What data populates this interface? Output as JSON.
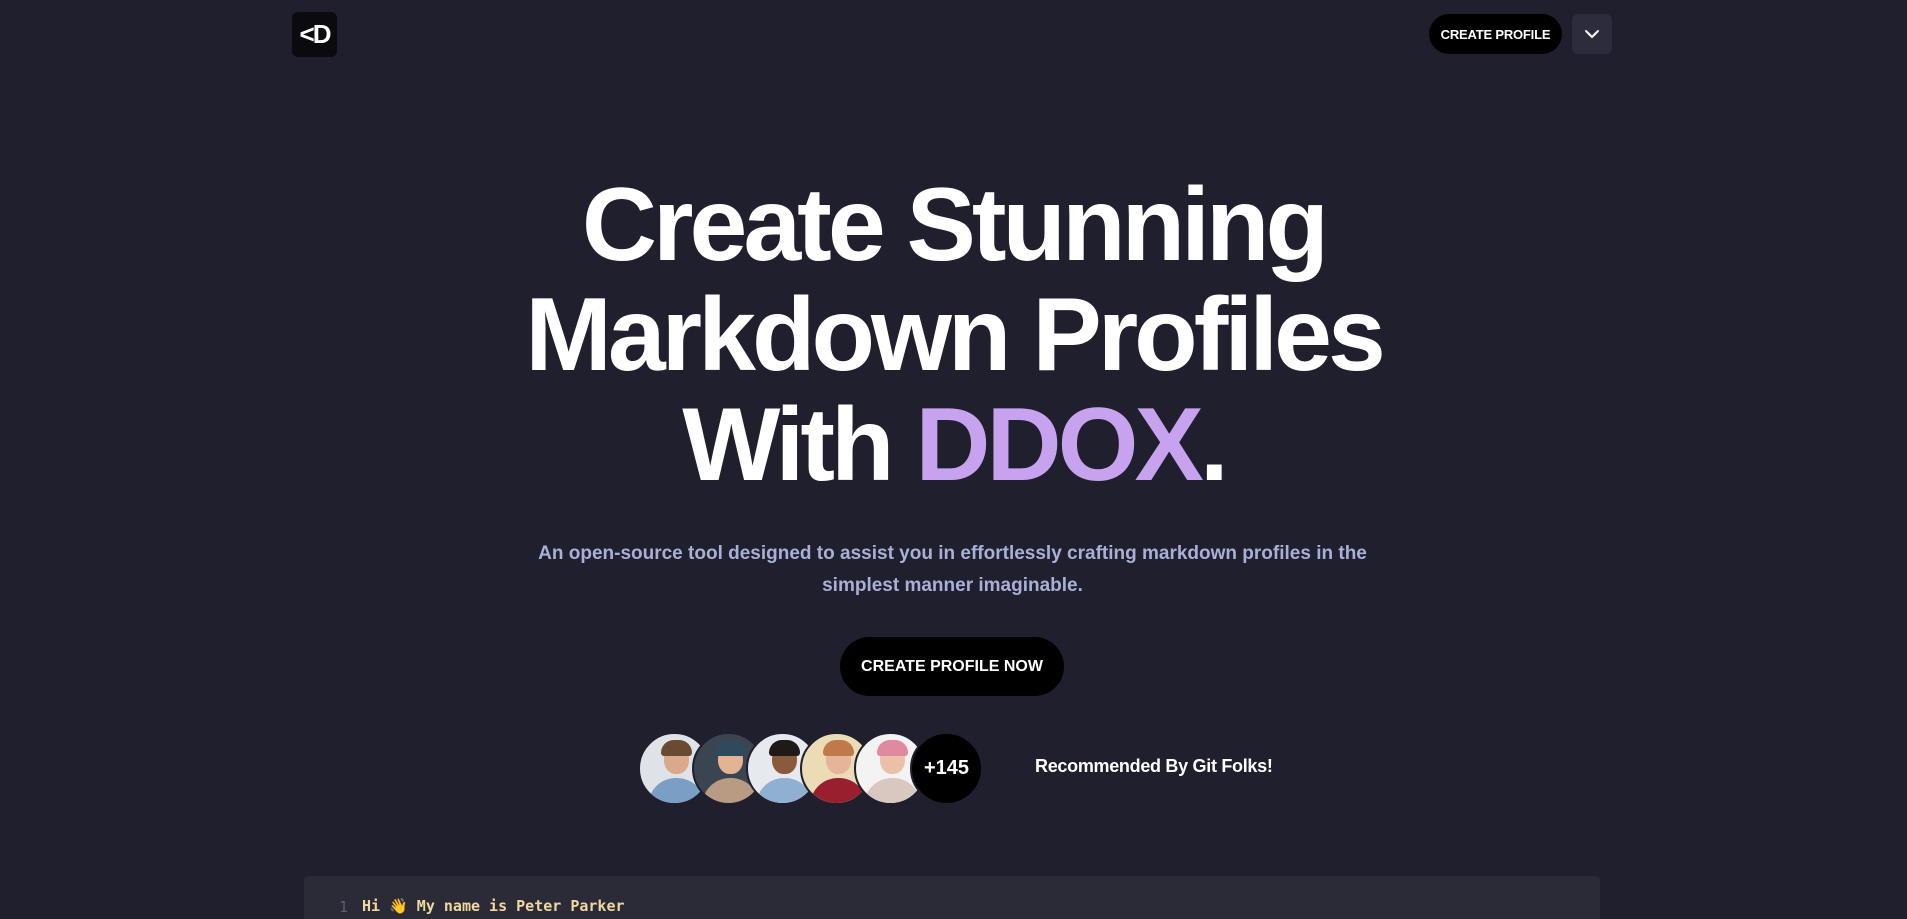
{
  "header": {
    "logo_text": "<D",
    "create_profile_label": "CREATE PROFILE",
    "menu_icon": "chevron-down-icon"
  },
  "hero": {
    "title_line1": "Create Stunning",
    "title_line2": "Markdown Profiles",
    "title_line3_prefix": "With ",
    "title_accent": "DDOX",
    "title_suffix": ".",
    "subtitle": "An open-source tool designed to assist you in effortlessly crafting markdown profiles in the simplest manner imaginable.",
    "cta_label": "CREATE PROFILE NOW"
  },
  "social_proof": {
    "avatars": [
      {
        "name": "avatar-1",
        "bg": "#dfe3e8",
        "skin": "#d9a98a",
        "hair": "#6b4a33",
        "shirt": "#7b9fc4"
      },
      {
        "name": "avatar-2",
        "bg": "#3b4552",
        "skin": "#e3b393",
        "hair": "#2e4a5c",
        "shirt": "#b89b82"
      },
      {
        "name": "avatar-3",
        "bg": "#e6e9ee",
        "skin": "#8a5a3c",
        "hair": "#1f1a17",
        "shirt": "#8fb0d0"
      },
      {
        "name": "avatar-4",
        "bg": "#ecdcb6",
        "skin": "#e6b49a",
        "hair": "#c07a4a",
        "shirt": "#9a1f2e"
      },
      {
        "name": "avatar-5",
        "bg": "#f3f3f3",
        "skin": "#eac1a8",
        "hair": "#e08aa0",
        "shirt": "#d9c8c0"
      }
    ],
    "extra_count": "+145",
    "label": "Recommended By Git Folks!"
  },
  "editor": {
    "line_number": "1",
    "code": "Hi 👋 My name is Peter Parker"
  },
  "colors": {
    "background": "#1f1f2e",
    "accent": "#c7a2ef",
    "subtitle": "#a9b0d6",
    "button": "#000000"
  }
}
